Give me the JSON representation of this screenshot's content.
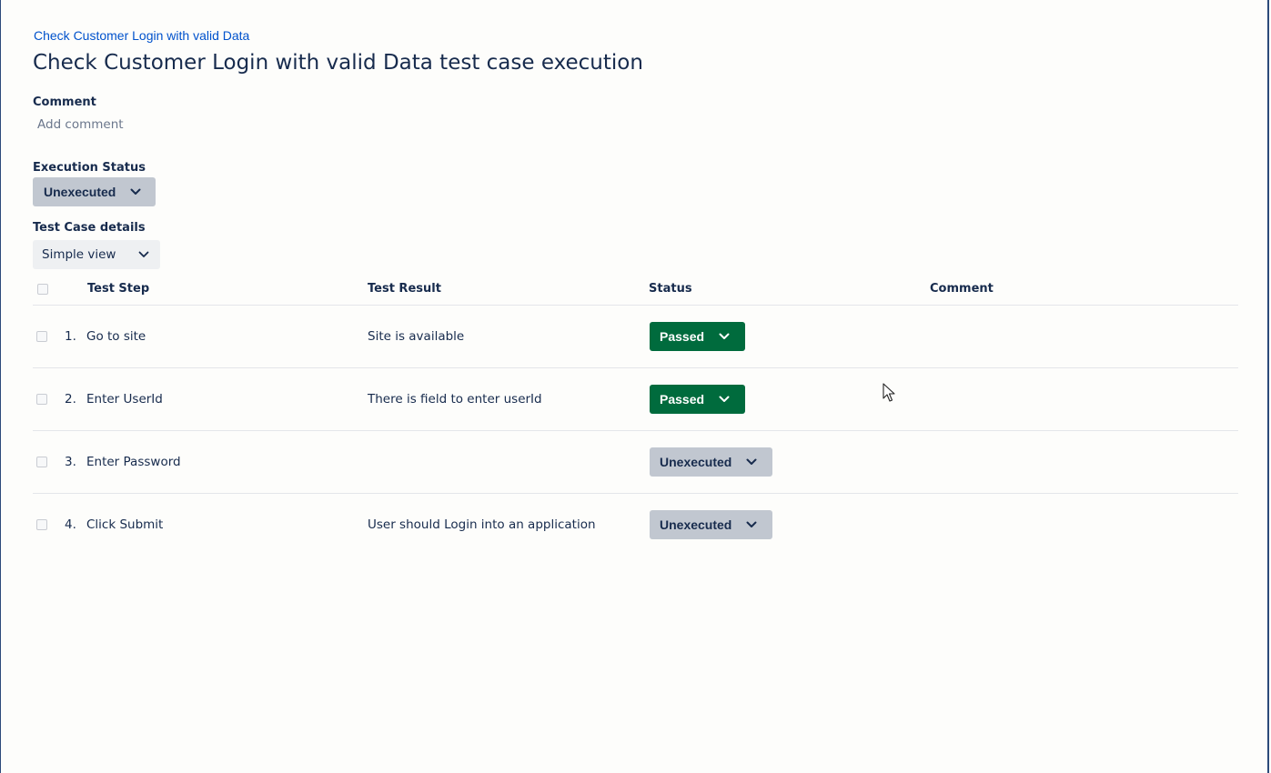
{
  "breadcrumb": "Check Customer Login with valid Data",
  "title": "Check Customer Login with valid Data test case execution",
  "comment": {
    "label": "Comment",
    "placeholder": "Add comment"
  },
  "execution_status": {
    "label": "Execution Status",
    "value": "Unexecuted"
  },
  "test_case_details": {
    "label": "Test Case details",
    "view": "Simple view"
  },
  "table": {
    "headers": {
      "step": "Test Step",
      "result": "Test Result",
      "status": "Status",
      "comment": "Comment"
    },
    "rows": [
      {
        "num": "1.",
        "step": "Go to site",
        "result": "Site is available",
        "status": "Passed",
        "comment": ""
      },
      {
        "num": "2.",
        "step": "Enter UserId",
        "result": "There is field to enter userId",
        "status": "Passed",
        "comment": ""
      },
      {
        "num": "3.",
        "step": "Enter Password",
        "result": "",
        "status": "Unexecuted",
        "comment": ""
      },
      {
        "num": "4.",
        "step": "Click Submit",
        "result": "User should Login into an application",
        "status": "Unexecuted",
        "comment": ""
      }
    ]
  },
  "colors": {
    "passed": "#006b3d",
    "unexecuted": "#c1c7d0",
    "link": "#0052cc",
    "text": "#172b4d"
  },
  "icons": {
    "dropdown": "chevron-down-icon",
    "pointer": "mouse-cursor-icon"
  }
}
